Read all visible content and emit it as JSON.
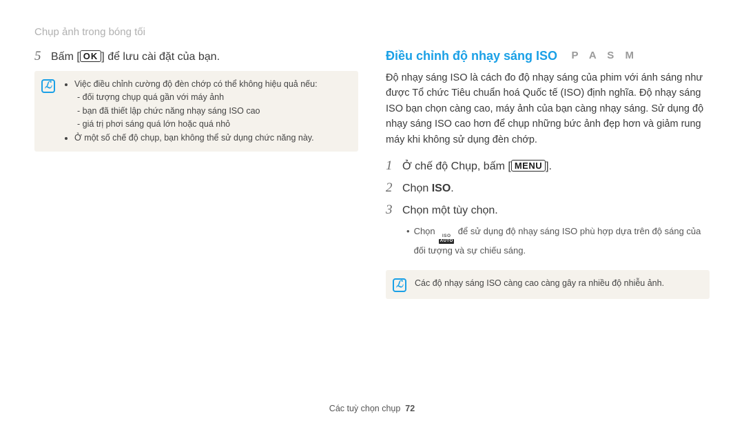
{
  "breadcrumb": "Chụp ảnh trong bóng tối",
  "left": {
    "step5_num": "5",
    "step5_pre": "Bấm [",
    "step5_btn": "OK",
    "step5_post": "] để lưu cài đặt của bạn.",
    "note": {
      "b1": "Việc điều chỉnh cường độ đèn chớp có thể không hiệu quả nếu:",
      "b1a": "đối tượng chụp quá gần với máy ảnh",
      "b1b": "bạn đã thiết lập chức năng nhạy sáng ISO cao",
      "b1c": "giá trị phơi sáng quá lớn hoặc quá nhỏ",
      "b2": "Ở một số chế độ chụp, bạn không thể sử dụng chức năng này."
    }
  },
  "right": {
    "title": "Điều chỉnh độ nhạy sáng ISO",
    "modes": "P A S M",
    "desc": "Độ nhạy sáng ISO là cách đo độ nhạy sáng của phim với ánh sáng như được Tổ chức Tiêu chuẩn hoá Quốc tế (ISO) định nghĩa. Độ nhạy sáng ISO bạn chọn càng cao, máy ảnh của bạn càng nhạy sáng. Sử dụng độ nhạy sáng ISO cao hơn để chụp những bức ảnh đẹp hơn và giảm rung máy khi không sử dụng đèn chớp.",
    "s1_num": "1",
    "s1_pre": "Ở chế độ Chụp, bấm [",
    "s1_btn": "MENU",
    "s1_post": "].",
    "s2_num": "2",
    "s2_pre": "Chọn ",
    "s2_bold": "ISO",
    "s2_post": ".",
    "s3_num": "3",
    "s3_text": "Chọn một tùy chọn.",
    "sub_pre": "Chọn ",
    "sub_icon_top": "ISO",
    "sub_icon_bot": "AUTO",
    "sub_post": " để sử dụng độ nhạy sáng ISO phù hợp dựa trên độ sáng của đối tượng và sự chiếu sáng.",
    "note_single": "Các độ nhạy sáng ISO càng cao càng gây ra nhiều độ nhiễu ảnh."
  },
  "footer": {
    "label": "Các tuỳ chọn chụp",
    "page": "72"
  }
}
